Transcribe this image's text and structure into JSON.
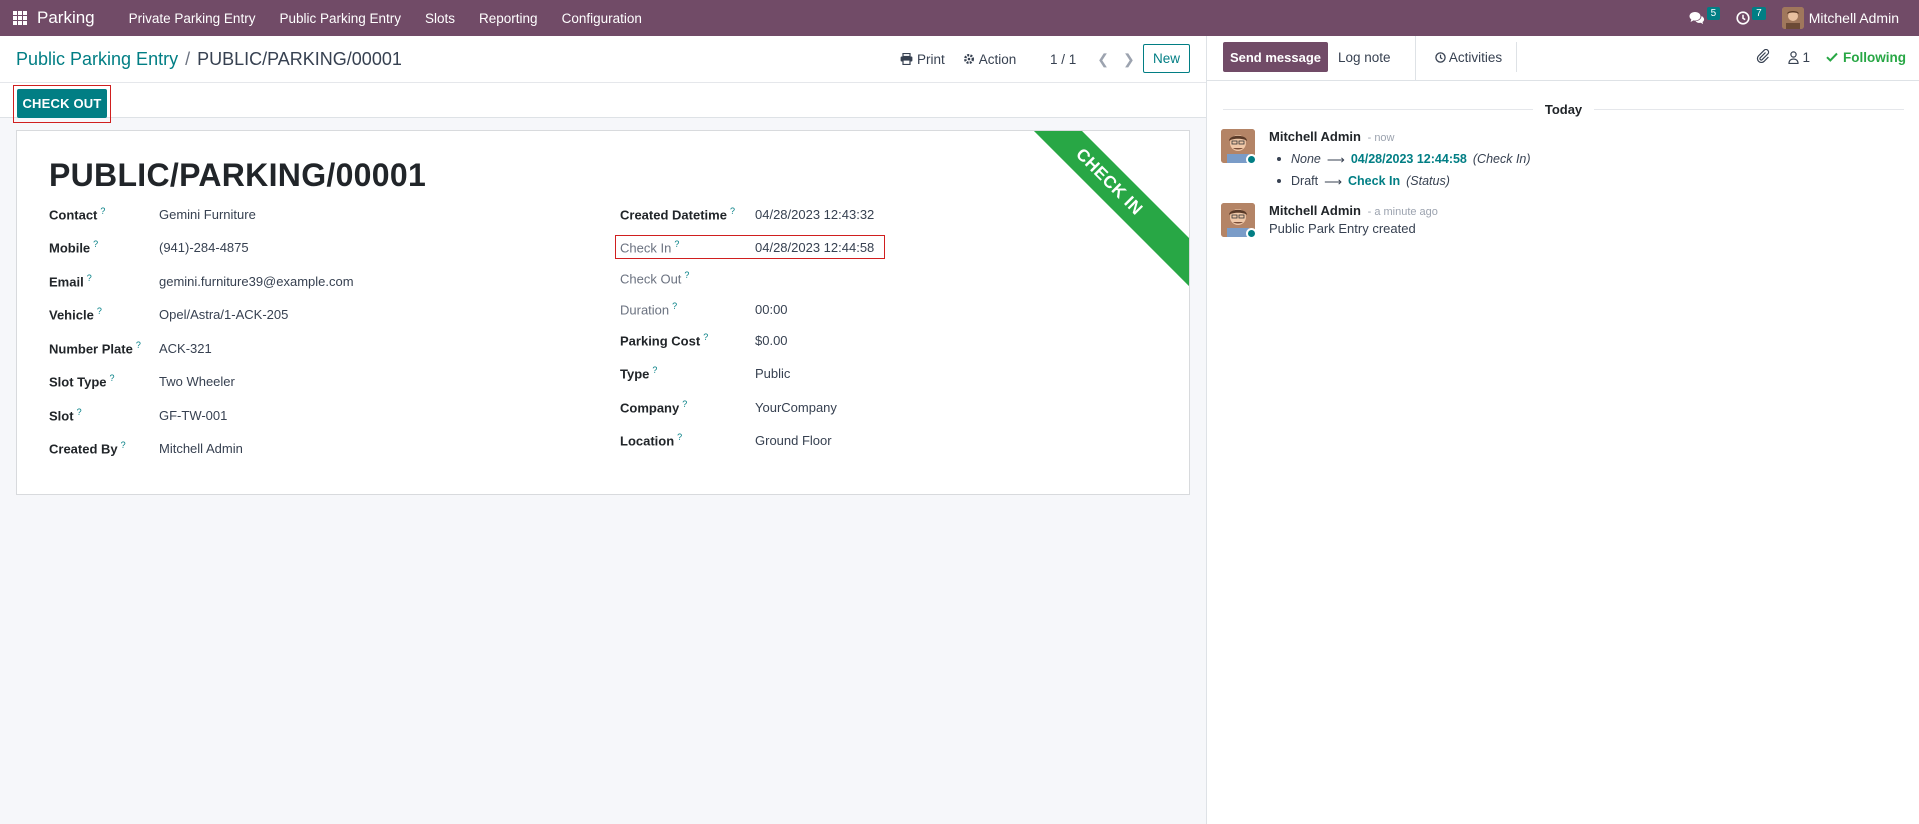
{
  "navbar": {
    "app_name": "Parking",
    "menu": [
      "Private Parking Entry",
      "Public Parking Entry",
      "Slots",
      "Reporting",
      "Configuration"
    ],
    "messages_count": "5",
    "activities_count": "7",
    "user_name": "Mitchell Admin"
  },
  "control_panel": {
    "breadcrumb_parent": "Public Parking Entry",
    "breadcrumb_separator": "/",
    "breadcrumb_current": "PUBLIC/PARKING/00001",
    "print_label": "Print",
    "action_label": "Action",
    "pager_value": "1 / 1",
    "new_label": "New"
  },
  "statusbar": {
    "checkout_label": "CHECK OUT"
  },
  "form": {
    "title": "PUBLIC/PARKING/00001",
    "ribbon": "CHECK IN",
    "left_fields": [
      {
        "label": "Contact",
        "value": "Gemini Furniture"
      },
      {
        "label": "Mobile",
        "value": "(941)-284-4875"
      },
      {
        "label": "Email",
        "value": "gemini.furniture39@example.com"
      },
      {
        "label": "Vehicle",
        "value": "Opel/Astra/1-ACK-205"
      },
      {
        "label": "Number Plate",
        "value": "ACK-321"
      },
      {
        "label": "Slot Type",
        "value": "Two Wheeler"
      },
      {
        "label": "Slot",
        "value": "GF-TW-001"
      },
      {
        "label": "Created By",
        "value": "Mitchell Admin"
      }
    ],
    "right_fields": [
      {
        "label": "Created Datetime",
        "value": "04/28/2023 12:43:32"
      },
      {
        "label": "Check In",
        "value": "04/28/2023 12:44:58"
      },
      {
        "label": "Check Out",
        "value": ""
      },
      {
        "label": "Duration",
        "value": "00:00"
      },
      {
        "label": "Parking Cost",
        "value": "$0.00"
      },
      {
        "label": "Type",
        "value": "Public"
      },
      {
        "label": "Company",
        "value": "YourCompany"
      },
      {
        "label": "Location",
        "value": "Ground Floor"
      }
    ],
    "help_marker": "?"
  },
  "chatter": {
    "send_message_label": "Send message",
    "log_note_label": "Log note",
    "activities_label": "Activities",
    "followers_count": "1",
    "following_label": "Following",
    "today_label": "Today",
    "messages": [
      {
        "author": "Mitchell Admin",
        "date": "- now",
        "tracking": [
          {
            "old": "None",
            "new": "04/28/2023 12:44:58",
            "field": "(Check In)"
          },
          {
            "old": "Draft",
            "new": "Check In",
            "field": "(Status)"
          }
        ]
      },
      {
        "author": "Mitchell Admin",
        "date": "- a minute ago",
        "body": "Public Park Entry created"
      }
    ]
  },
  "colors": {
    "navbar": "#714b67",
    "primary": "#017e84",
    "ribbon": "#28a745",
    "highlight": "#d01f1f"
  }
}
